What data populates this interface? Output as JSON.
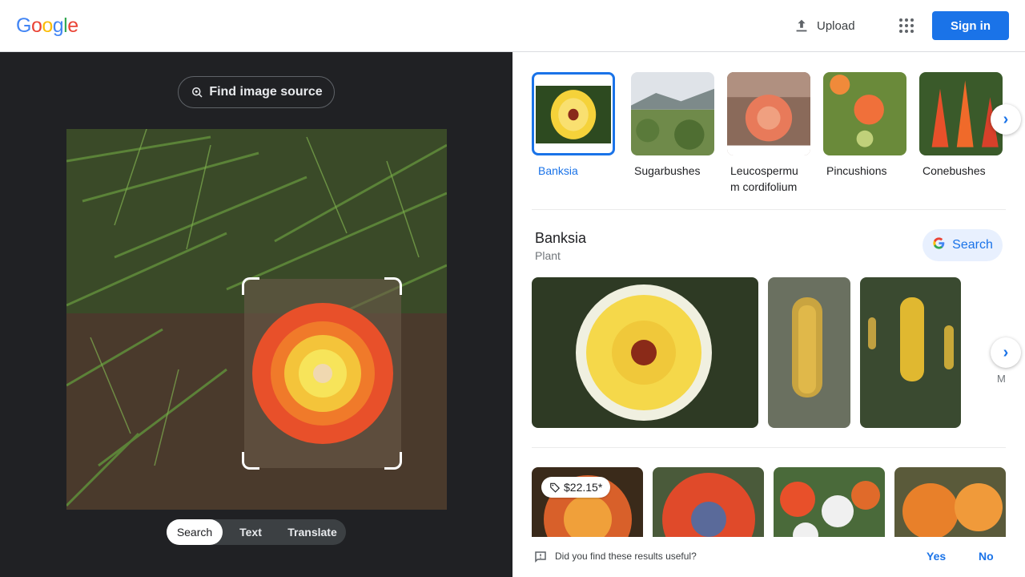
{
  "header": {
    "logo_letters": [
      {
        "ch": "G",
        "color": "#4285F4"
      },
      {
        "ch": "o",
        "color": "#EA4335"
      },
      {
        "ch": "o",
        "color": "#FBBC05"
      },
      {
        "ch": "g",
        "color": "#4285F4"
      },
      {
        "ch": "l",
        "color": "#34A853"
      },
      {
        "ch": "e",
        "color": "#EA4335"
      }
    ],
    "upload_label": "Upload",
    "apps_icon": "apps-grid-icon",
    "signin_label": "Sign in"
  },
  "left": {
    "find_source_label": "Find image source",
    "modes": [
      "Search",
      "Text",
      "Translate"
    ],
    "active_mode": "Search"
  },
  "right": {
    "chips": [
      {
        "label": "Banksia",
        "selected": true
      },
      {
        "label": "Sugarbushes",
        "selected": false
      },
      {
        "label": "Leucospermu m cordifolium",
        "selected": false
      },
      {
        "label": "Pincushions",
        "selected": false
      },
      {
        "label": "Conebushes",
        "selected": false
      }
    ],
    "knowledge": {
      "title": "Banksia",
      "subtitle": "Plant",
      "search_label": "Search",
      "more_label": "M"
    },
    "results": {
      "price_tag": "$22.15*"
    },
    "feedback": {
      "question": "Did you find these results useful?",
      "yes": "Yes",
      "no": "No"
    }
  },
  "colors": {
    "accent": "#1a73e8",
    "dark_panel": "#202124"
  }
}
